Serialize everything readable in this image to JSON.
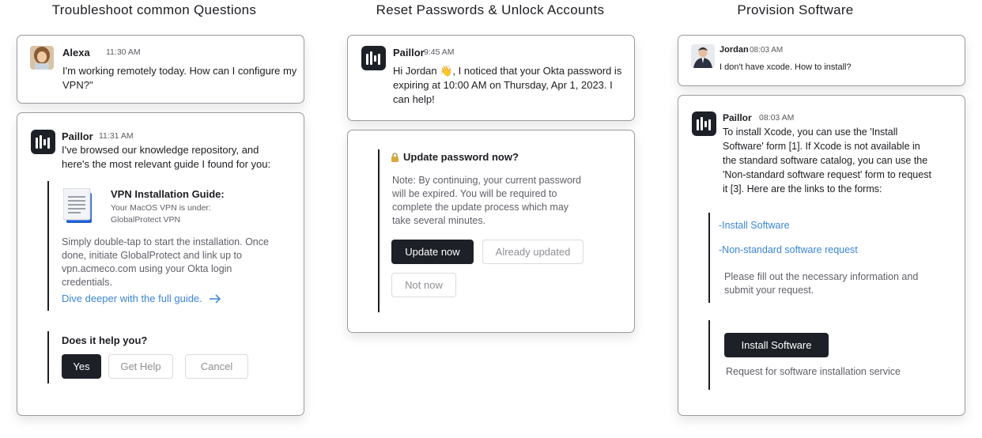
{
  "titles": {
    "col1": "Troubleshoot common Questions",
    "col2": "Reset Passwords & Unlock Accounts",
    "col3": "Provision Software"
  },
  "col1": {
    "user_name": "Alexa",
    "user_time": "11:30 AM",
    "user_message": "I'm working remotely today. How can I configure my VPN?\"",
    "bot_name": "Paillor",
    "bot_time": "11:31 AM",
    "bot_intro": "I've browsed our knowledge repository, and here's the most relevant guide I found for you:",
    "guide_title": "VPN Installation Guide:",
    "guide_subtitle": "Your MacOS VPN is under: GlobalProtect VPN",
    "guide_body": "Simply double-tap to start the installation. Once done, initiate GlobalProtect and link up to vpn.acmeco.com using your Okta login credentials.",
    "guide_link": "Dive deeper with the full guide.",
    "feedback_question": "Does it help you?",
    "btn_yes": "Yes",
    "btn_get_help": "Get Help",
    "btn_cancel": "Cancel"
  },
  "col2": {
    "bot_name": "Paillor",
    "bot_time": "9:45 AM",
    "message": "Hi Jordan 👋, I noticed that your Okta password is expiring at 10:00 AM on Thursday, Apr 1, 2023. I can help!",
    "prompt_title": "Update password now?",
    "note": "Note: By continuing, your current password will be expired. You will be required to complete the update process which may take several minutes.",
    "btn_update": "Update now",
    "btn_already": "Already updated",
    "btn_not_now": "Not now"
  },
  "col3": {
    "user_name": "Jordan",
    "user_time": "08:03 AM",
    "user_message": "I don't have xcode. How to install?",
    "bot_name": "Paillor",
    "bot_time": "08:03 AM",
    "bot_message": "To install Xcode, you can use the 'Install Software' form [1]. If Xcode is not available in the standard software catalog, you can use the 'Non-standard software request' form to request it [3]. Here are the links to the forms:",
    "link_install": "-Install Software",
    "link_nonstandard": "-Non-standard software request",
    "fill_note": "Please fill out the necessary information and submit your request.",
    "btn_install": "Install Software",
    "install_caption": "Request for software installation service"
  },
  "colors": {
    "dark": "#1d2027",
    "link": "#3b86d6",
    "border": "#9a9aa0"
  },
  "icons": [
    "paillor-logo-icon",
    "document-icon",
    "arrow-right-icon",
    "lock-icon"
  ]
}
